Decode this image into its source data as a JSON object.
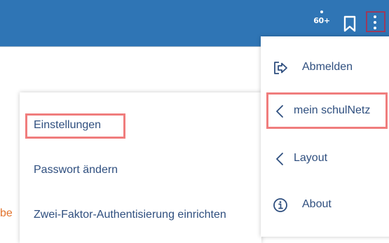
{
  "topbar": {
    "notification_count": "60+",
    "background_color": "#2f75b5",
    "icons": [
      "notification-dot-icon",
      "bookmark-icon",
      "kebab-menu-icon"
    ]
  },
  "page": {
    "partial_text": "be"
  },
  "main_menu": {
    "items": [
      {
        "label": "Abmelden",
        "icon": "logout-icon"
      },
      {
        "label": "mein schulNetz",
        "icon": "chevron-left-icon"
      },
      {
        "label": "Layout",
        "icon": "chevron-left-icon"
      },
      {
        "label": "About",
        "icon": "info-icon"
      }
    ]
  },
  "submenu": {
    "items": [
      {
        "label": "Einstellungen"
      },
      {
        "label": "Passwort ändern"
      },
      {
        "label": "Zwei-Faktor-Authentisierung einrichten"
      }
    ]
  },
  "colors": {
    "text": "#2f4f7f",
    "highlight": "#f07d7d",
    "kebab_highlight": "#9a3a5d",
    "page_text": "#e2732c"
  }
}
